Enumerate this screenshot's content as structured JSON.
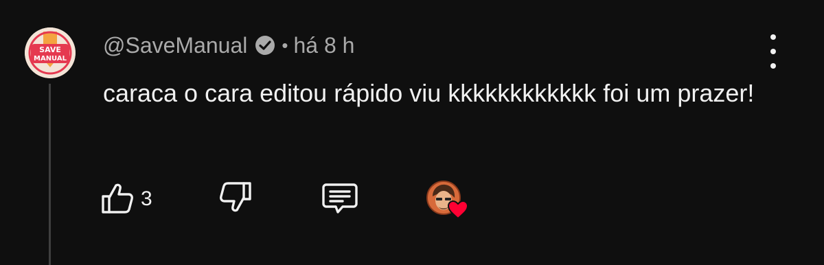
{
  "comment": {
    "author": "@SaveManual",
    "verified": true,
    "separator": "•",
    "time": "há 8 h",
    "text": "caraca o cara editou rápido viu kkkkkkkkkkkk foi um prazer!",
    "avatar_text": [
      "SAVE",
      "MANUAL"
    ],
    "avatar_colors": {
      "ring": "#e53950",
      "arrow": "#f4a340",
      "bg": "#f3e4d7"
    }
  },
  "actions": {
    "like_icon": "thumbs-up-icon",
    "like_count": "3",
    "dislike_icon": "thumbs-down-icon",
    "reply_icon": "comment-reply-icon",
    "creator_heart": "creator-heart-icon",
    "heart_color": "#ff0033"
  },
  "menu_icon": "more-vertical-icon"
}
